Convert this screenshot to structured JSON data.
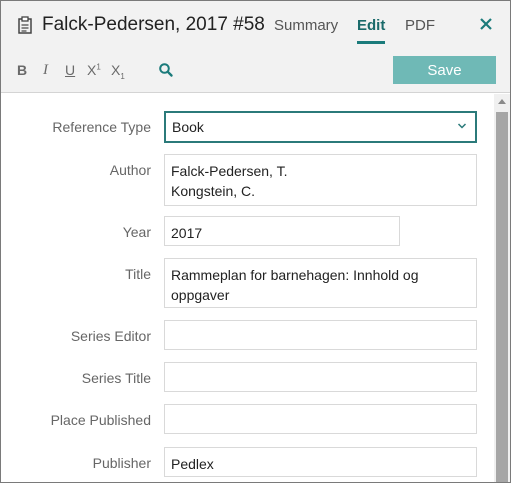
{
  "header": {
    "reference_title": "Falck-Pedersen, 2017 #58",
    "tabs": {
      "summary": "Summary",
      "edit": "Edit",
      "pdf": "PDF"
    },
    "active_tab": "Edit"
  },
  "toolbar": {
    "bold": "B",
    "italic": "I",
    "underline": "U",
    "superscript_base": "X",
    "superscript_mark": "1",
    "subscript_base": "X",
    "subscript_mark": "1",
    "save_label": "Save"
  },
  "form": {
    "reference_type": {
      "label": "Reference Type",
      "value": "Book"
    },
    "author": {
      "label": "Author",
      "lines": [
        "Falck-Pedersen, T.",
        "Kongstein, C."
      ]
    },
    "year": {
      "label": "Year",
      "value": "2017"
    },
    "title": {
      "label": "Title",
      "lines": [
        "Rammeplan for barnehagen: Innhold og",
        "oppgaver"
      ]
    },
    "series_editor": {
      "label": "Series Editor",
      "value": ""
    },
    "series_title": {
      "label": "Series Title",
      "value": ""
    },
    "place_published": {
      "label": "Place Published",
      "value": ""
    },
    "publisher": {
      "label": "Publisher",
      "value": "Pedlex"
    }
  },
  "colors": {
    "accent": "#1b7b7b",
    "save_button": "#6fb9b6",
    "header_bg": "#f2f2f2"
  },
  "icons": [
    "clipboard-icon",
    "close-icon",
    "search-icon",
    "chevron-down-icon",
    "scroll-up-arrow-icon"
  ]
}
